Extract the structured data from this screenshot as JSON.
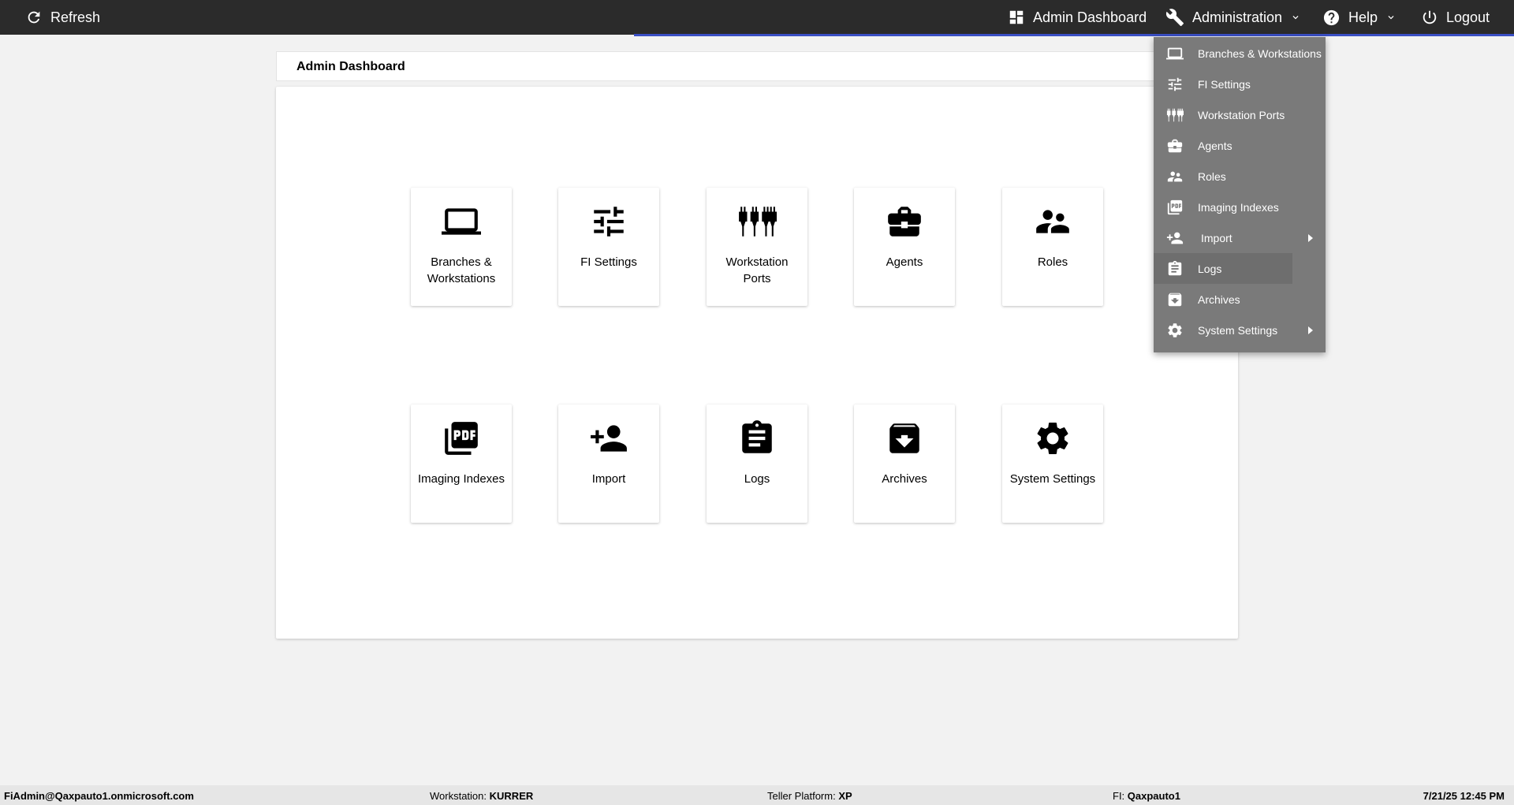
{
  "topbar": {
    "refresh_label": "Refresh",
    "admin_dashboard_label": "Admin Dashboard",
    "administration_label": "Administration",
    "help_label": "Help",
    "logout_label": "Logout"
  },
  "page": {
    "title": "Admin Dashboard"
  },
  "tiles": [
    {
      "label": "Branches & Workstations",
      "icon": "laptop-icon"
    },
    {
      "label": "FI Settings",
      "icon": "tune-icon"
    },
    {
      "label": "Workstation Ports",
      "icon": "ports-icon"
    },
    {
      "label": "Agents",
      "icon": "briefcase-icon"
    },
    {
      "label": "Roles",
      "icon": "people-icon"
    },
    {
      "label": "Imaging Indexes",
      "icon": "pdf-icon"
    },
    {
      "label": "Import",
      "icon": "person-add-icon"
    },
    {
      "label": "Logs",
      "icon": "clipboard-icon"
    },
    {
      "label": "Archives",
      "icon": "archive-icon"
    },
    {
      "label": "System Settings",
      "icon": "gear-icon"
    }
  ],
  "menu": [
    {
      "label": "Branches & Workstations",
      "icon": "laptop-icon"
    },
    {
      "label": "FI Settings",
      "icon": "tune-icon"
    },
    {
      "label": "Workstation Ports",
      "icon": "ports-icon"
    },
    {
      "label": "Agents",
      "icon": "briefcase-icon"
    },
    {
      "label": "Roles",
      "icon": "people-icon"
    },
    {
      "label": "Imaging Indexes",
      "icon": "pdf-icon"
    },
    {
      "label": "Import",
      "icon": "person-add-icon",
      "submenu": true
    },
    {
      "label": "Logs",
      "icon": "clipboard-icon",
      "hovered": true
    },
    {
      "label": "Archives",
      "icon": "archive-icon"
    },
    {
      "label": "System Settings",
      "icon": "gear-icon",
      "submenu": true
    }
  ],
  "footer": {
    "user": "FiAdmin@Qaxpauto1.onmicrosoft.com",
    "workstation_label": "Workstation:",
    "workstation_value": "KURRER",
    "platform_label": "Teller Platform:",
    "platform_value": "XP",
    "fi_label": "FI:",
    "fi_value": "Qaxpauto1",
    "datetime": "7/21/25 12:45 PM"
  },
  "colors": {
    "topbar": "#2b2b2b",
    "accent": "#3a4fc4",
    "menu_bg": "#7a7a7a"
  }
}
